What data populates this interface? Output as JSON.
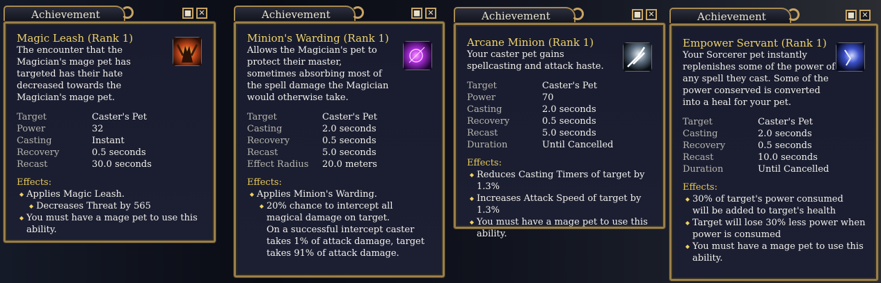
{
  "windows": [
    {
      "title": "Achievement",
      "name": "Magic Leash (Rank 1)",
      "description": "The encounter that the Magician's mage pet has targeted has their hate decreased towards the Magician's mage pet.",
      "icon": "magic-leash-icon",
      "stats": [
        {
          "label": "Target",
          "value": "Caster's Pet"
        },
        {
          "label": "Power",
          "value": "32"
        },
        {
          "label": "Casting",
          "value": "Instant"
        },
        {
          "label": "Recovery",
          "value": "0.5 seconds"
        },
        {
          "label": "Recast",
          "value": "30.0 seconds"
        }
      ],
      "effects_heading": "Effects:",
      "effects": [
        {
          "text": "Applies Magic Leash.",
          "level": 1
        },
        {
          "text": "Decreases Threat by 565",
          "level": 2
        },
        {
          "text": "You must have a mage pet to use this ability.",
          "level": 1
        }
      ]
    },
    {
      "title": "Achievement",
      "name": "Minion's Warding (Rank 1)",
      "description": "Allows the Magician's pet to protect their master, sometimes absorbing most of the spell damage the Magician would otherwise take.",
      "icon": "minions-warding-icon",
      "stats": [
        {
          "label": "Target",
          "value": "Caster's Pet"
        },
        {
          "label": "Casting",
          "value": "2.0 seconds"
        },
        {
          "label": "Recovery",
          "value": "0.5 seconds"
        },
        {
          "label": "Recast",
          "value": "5.0 seconds"
        },
        {
          "label": "Effect Radius",
          "value": "20.0 meters"
        }
      ],
      "effects_heading": "Effects:",
      "effects": [
        {
          "text": "Applies Minion's Warding.",
          "level": 1
        },
        {
          "text": "20% chance to intercept all magical damage on target.\nOn a successful intercept caster takes 1% of attack damage, target takes 91% of attack damage.",
          "level": 2
        }
      ]
    },
    {
      "title": "Achievement",
      "name": "Arcane Minion (Rank 1)",
      "description": "Your caster pet gains spellcasting and attack haste.",
      "icon": "arcane-minion-icon",
      "stats": [
        {
          "label": "Target",
          "value": "Caster's Pet"
        },
        {
          "label": "Power",
          "value": "70"
        },
        {
          "label": "Casting",
          "value": "2.0 seconds"
        },
        {
          "label": "Recovery",
          "value": "0.5 seconds"
        },
        {
          "label": "Recast",
          "value": "5.0 seconds"
        },
        {
          "label": "Duration",
          "value": "Until Cancelled"
        }
      ],
      "effects_heading": "Effects:",
      "effects": [
        {
          "text": "Reduces Casting Timers of target by 1.3%",
          "level": 1
        },
        {
          "text": "Increases Attack Speed of target by 1.3%",
          "level": 1
        },
        {
          "text": "You must have a mage pet to use this ability.",
          "level": 1
        }
      ]
    },
    {
      "title": "Achievement",
      "name": "Empower Servant (Rank 1)",
      "description": "Your Sorcerer pet instantly replenishes some of the power of any spell they cast. Some of the power conserved is converted into a heal for your pet.",
      "icon": "empower-servant-icon",
      "stats": [
        {
          "label": "Target",
          "value": "Caster's Pet"
        },
        {
          "label": "Casting",
          "value": "2.0 seconds"
        },
        {
          "label": "Recovery",
          "value": "0.5 seconds"
        },
        {
          "label": "Recast",
          "value": "10.0 seconds"
        },
        {
          "label": "Duration",
          "value": "Until Cancelled"
        }
      ],
      "effects_heading": "Effects:",
      "effects": [
        {
          "text": "30% of target's power consumed will be added to target's health",
          "level": 1
        },
        {
          "text": "Target will lose 30% less power when power is consumed",
          "level": 1
        },
        {
          "text": "You must have a mage pet to use this ability.",
          "level": 1
        }
      ]
    }
  ],
  "controls": {
    "minimize_glyph": "■",
    "close_glyph": "✕"
  },
  "colors": {
    "gold_border": "#9a7f4a",
    "name": "#efd36a",
    "panel_bg": "#1a1d30"
  }
}
